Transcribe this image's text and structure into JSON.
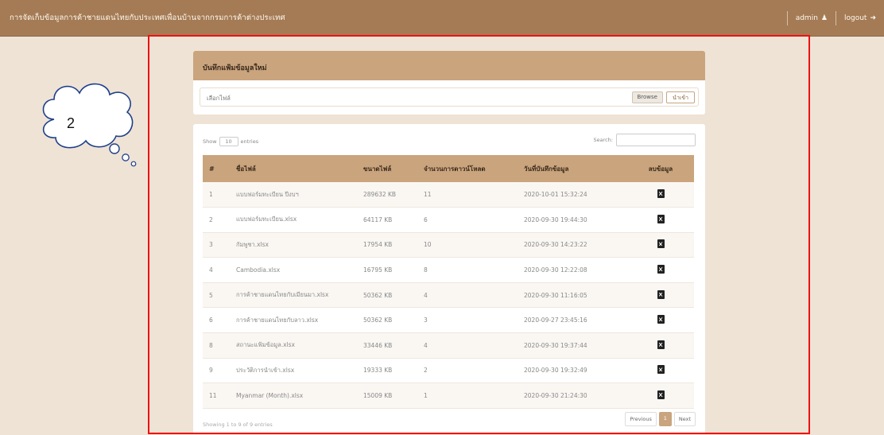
{
  "header": {
    "app_title": "การจัดเก็บข้อมูลการค้าชายแดนไทยกับประเทศเพื่อนบ้านจากกรมการค้าต่างประเทศ",
    "user_label": "admin",
    "logout_label": "logout"
  },
  "annotation": {
    "number": "2"
  },
  "upload": {
    "panel_title": "บันทึกแฟ้มข้อมูลใหม่",
    "file_placeholder": "เลือกไฟล์",
    "browse_label": "Browse",
    "upload_label": "นำเข้า"
  },
  "table": {
    "show_label": "Show",
    "length_value": "10",
    "entries_label": "entries",
    "search_label": "Search:",
    "columns": [
      "#",
      "ชื่อไฟล์",
      "ขนาดไฟล์",
      "จำนวนการดาวน์โหลด",
      "วันที่บันทึกข้อมูล",
      "ลบข้อมูล"
    ],
    "rows": [
      {
        "num": "1",
        "name": "แบบฟอร์มทะเบียน ปีงบฯ",
        "size": "289632 KB",
        "count": "11",
        "date": "2020-10-01 15:32:24"
      },
      {
        "num": "2",
        "name": "แบบฟอร์มทะเบียน.xlsx",
        "size": "64117 KB",
        "count": "6",
        "date": "2020-09-30 19:44:30"
      },
      {
        "num": "3",
        "name": "กัมพูชา.xlsx",
        "size": "17954 KB",
        "count": "10",
        "date": "2020-09-30 14:23:22"
      },
      {
        "num": "4",
        "name": "Cambodia.xlsx",
        "size": "16795 KB",
        "count": "8",
        "date": "2020-09-30 12:22:08"
      },
      {
        "num": "5",
        "name": "การค้าชายแดนไทยกับเมียนมา.xlsx",
        "size": "50362 KB",
        "count": "4",
        "date": "2020-09-30 11:16:05"
      },
      {
        "num": "6",
        "name": "การค้าชายแดนไทยกับลาว.xlsx",
        "size": "50362 KB",
        "count": "3",
        "date": "2020-09-27 23:45:16"
      },
      {
        "num": "8",
        "name": "สถานะแฟ้มข้อมูล.xlsx",
        "size": "33446 KB",
        "count": "4",
        "date": "2020-09-30 19:37:44"
      },
      {
        "num": "9",
        "name": "ประวัติการนำเข้า.xlsx",
        "size": "19333 KB",
        "count": "2",
        "date": "2020-09-30 19:32:49"
      },
      {
        "num": "11",
        "name": "Myanmar (Month).xlsx",
        "size": "15009 KB",
        "count": "1",
        "date": "2020-09-30 21:24:30"
      }
    ],
    "footer_info": "Showing 1 to 9 of 9 entries",
    "prev_label": "Previous",
    "current_page": "1",
    "next_label": "Next"
  },
  "colors": {
    "topbar": "#a47b55",
    "panel_header": "#c9a47d",
    "page_bg": "#efe3d6",
    "highlight_border": "#ee1111"
  }
}
